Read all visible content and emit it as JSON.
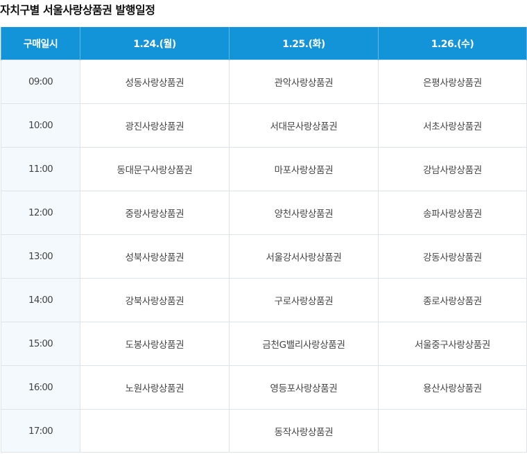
{
  "title": "자치구별 서울사랑상품권 발행일정",
  "table": {
    "headers": [
      "구매일시",
      "1.24.(월)",
      "1.25.(화)",
      "1.26.(수)"
    ],
    "rows": [
      [
        "09:00",
        "성동사랑상품권",
        "관악사랑상품권",
        "은평사랑상품권"
      ],
      [
        "10:00",
        "광진사랑상품권",
        "서대문사랑상품권",
        "서초사랑상품권"
      ],
      [
        "11:00",
        "동대문구사랑상품권",
        "마포사랑상품권",
        "강남사랑상품권"
      ],
      [
        "12:00",
        "중랑사랑상품권",
        "양천사랑상품권",
        "송파사랑상품권"
      ],
      [
        "13:00",
        "성북사랑상품권",
        "서울강서사랑상품권",
        "강동사랑상품권"
      ],
      [
        "14:00",
        "강북사랑상품권",
        "구로사랑상품권",
        "종로사랑상품권"
      ],
      [
        "15:00",
        "도봉사랑상품권",
        "금천G밸리사랑상품권",
        "서울중구사랑상품권"
      ],
      [
        "16:00",
        "노원사랑상품권",
        "영등포사랑상품권",
        "용산사랑상품권"
      ],
      [
        "17:00",
        "",
        "동작사랑상품권",
        ""
      ]
    ]
  },
  "colors": {
    "header_bg": "#1393d8",
    "time_col_bg": "#f3f9fc",
    "border": "#dde3e8"
  }
}
